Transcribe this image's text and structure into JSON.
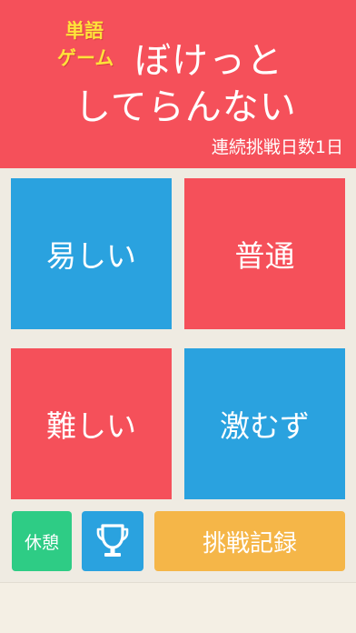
{
  "header": {
    "tag_line1": "単語",
    "tag_line2": "ゲーム",
    "title_line1": "ぼけっと",
    "title_line2": "してらんない",
    "streak": "連続挑戦日数1日"
  },
  "levels": {
    "easy": "易しい",
    "normal": "普通",
    "hard": "難しい",
    "extreme": "激むず"
  },
  "bottom": {
    "rest_label": "休憩",
    "trophy_icon": "trophy-icon",
    "record_label": "挑戦記録"
  },
  "colors": {
    "red": "#f5505a",
    "blue": "#2aa2df",
    "green": "#2ecc85",
    "orange": "#f5b648",
    "yellow": "#ffe23a"
  }
}
